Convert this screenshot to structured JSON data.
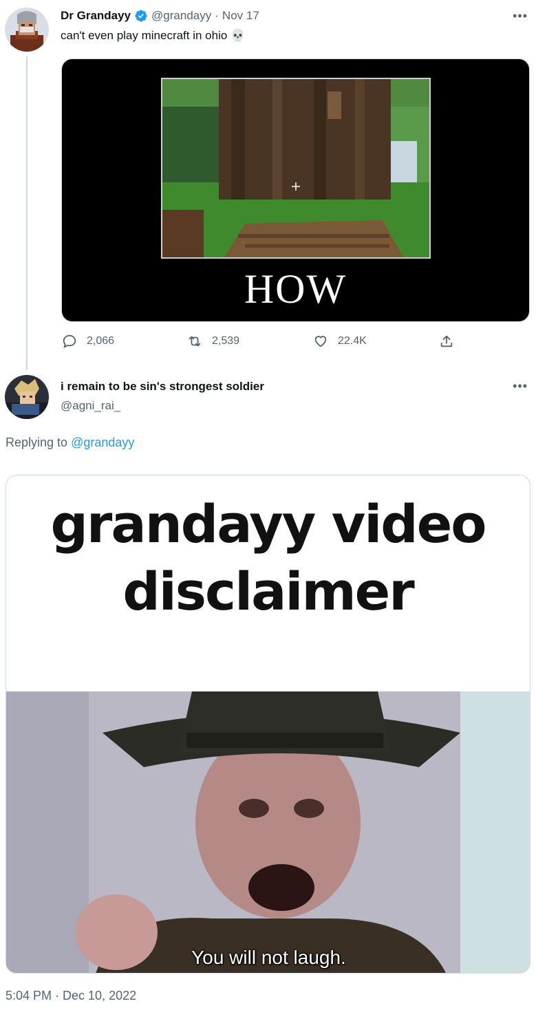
{
  "tweet": {
    "display_name": "Dr Grandayy",
    "handle": "@grandayy",
    "separator": "·",
    "date": "Nov 17",
    "text": "can't even play minecraft in ohio 💀",
    "media_caption": "HOW",
    "stats": {
      "replies": "2,066",
      "retweets": "2,539",
      "likes": "22.4K"
    }
  },
  "reply": {
    "display_name": "i remain to be sin's strongest soldier",
    "handle": "@agni_rai_",
    "replying_prefix": "Replying to",
    "replying_to": "@grandayy",
    "meme_title": "grandayy video disclaimer",
    "meme_caption": "You will not laugh.",
    "timestamp": "5:04 PM · Dec 10, 2022"
  },
  "icons": {
    "more": "more-icon",
    "verified": "verified-badge-icon",
    "reply": "reply-icon",
    "retweet": "retweet-icon",
    "like": "like-icon",
    "share": "share-icon"
  },
  "colors": {
    "accent": "#1d9bf0",
    "secondary_text": "#536471",
    "primary_text": "#0f1419",
    "thread_line": "#cfd9de"
  }
}
